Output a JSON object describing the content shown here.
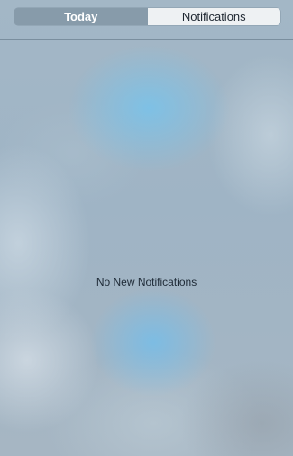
{
  "segmented_control": {
    "tabs": [
      {
        "label": "Today",
        "selected": false
      },
      {
        "label": "Notifications",
        "selected": true
      }
    ]
  },
  "notifications": {
    "empty_message": "No New Notifications"
  }
}
